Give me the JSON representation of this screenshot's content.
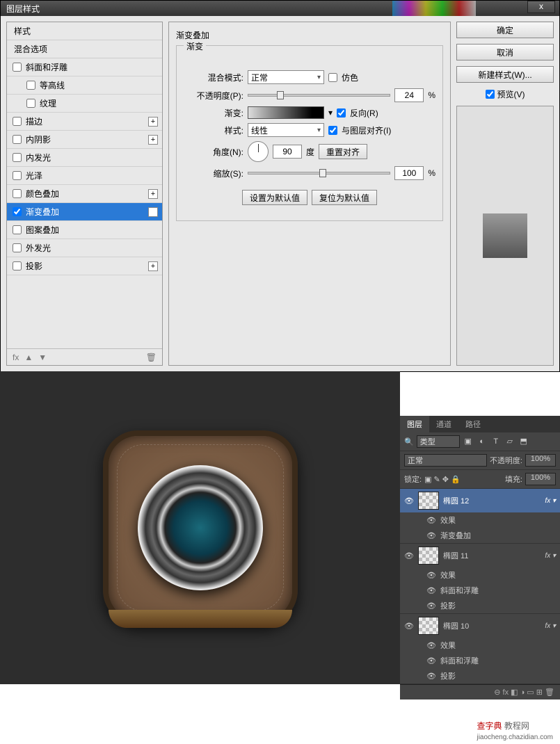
{
  "dialog": {
    "title": "图层样式",
    "close_x": "x",
    "styles": {
      "header": "样式",
      "blend_options": "混合选项",
      "items": [
        {
          "label": "斜面和浮雕",
          "checked": false,
          "indent": false,
          "plus": false
        },
        {
          "label": "等高线",
          "checked": false,
          "indent": true,
          "plus": false
        },
        {
          "label": "纹理",
          "checked": false,
          "indent": true,
          "plus": false
        },
        {
          "label": "描边",
          "checked": false,
          "indent": false,
          "plus": true
        },
        {
          "label": "内阴影",
          "checked": false,
          "indent": false,
          "plus": true
        },
        {
          "label": "内发光",
          "checked": false,
          "indent": false,
          "plus": false
        },
        {
          "label": "光泽",
          "checked": false,
          "indent": false,
          "plus": false
        },
        {
          "label": "颜色叠加",
          "checked": false,
          "indent": false,
          "plus": true
        },
        {
          "label": "渐变叠加",
          "checked": true,
          "indent": false,
          "plus": true,
          "active": true
        },
        {
          "label": "图案叠加",
          "checked": false,
          "indent": false,
          "plus": false
        },
        {
          "label": "外发光",
          "checked": false,
          "indent": false,
          "plus": false
        },
        {
          "label": "投影",
          "checked": false,
          "indent": false,
          "plus": true
        }
      ],
      "footer_fx": "fx",
      "footer_up": "▲",
      "footer_down": "▼",
      "footer_trash": "🗑"
    },
    "gradient_overlay": {
      "title": "渐变叠加",
      "group_label": "渐变",
      "blend_mode_label": "混合模式:",
      "blend_mode_value": "正常",
      "dither_label": "仿色",
      "dither_checked": false,
      "opacity_label": "不透明度(P):",
      "opacity_value": "24",
      "opacity_unit": "%",
      "gradient_label": "渐变:",
      "reverse_label": "反向(R)",
      "reverse_checked": true,
      "style_label": "样式:",
      "style_value": "线性",
      "align_label": "与图层对齐(I)",
      "align_checked": true,
      "angle_label": "角度(N):",
      "angle_value": "90",
      "angle_unit": "度",
      "reset_align": "重置对齐",
      "scale_label": "缩放(S):",
      "scale_value": "100",
      "scale_unit": "%",
      "make_default": "设置为默认值",
      "reset_default": "复位为默认值"
    },
    "buttons": {
      "ok": "确定",
      "cancel": "取消",
      "new_style": "新建样式(W)...",
      "preview": "预览(V)",
      "preview_checked": true
    }
  },
  "layers_panel": {
    "tabs": {
      "layers": "图层",
      "channels": "通道",
      "paths": "路径"
    },
    "filter_kind_icon": "🔍",
    "filter_kind": "类型",
    "icons": {
      "img": "▣",
      "adj": "◐",
      "text": "T",
      "shape": "▱",
      "smart": "⬒"
    },
    "blend_mode": "正常",
    "opacity_label": "不透明度:",
    "opacity_value": "100%",
    "lock_label": "锁定:",
    "lock_icons": "▣ ✎ ✥ 🔒",
    "fill_label": "填充:",
    "fill_value": "100%",
    "layers": [
      {
        "name": "椭圆 12",
        "active": true,
        "effects_label": "效果",
        "effects": [
          "渐变叠加"
        ]
      },
      {
        "name": "椭圆 11",
        "active": false,
        "effects_label": "效果",
        "effects": [
          "斜面和浮雕",
          "投影"
        ]
      },
      {
        "name": "椭圆 10",
        "active": false,
        "effects_label": "效果",
        "effects": [
          "斜面和浮雕",
          "投影"
        ]
      }
    ],
    "fx_text": "fx",
    "link_icon": "⬭",
    "footer_icons": "⊖  fx  ◧  ◑  ▭  ⊞  🗑"
  },
  "watermark": {
    "cn": "查字典",
    "rest": " 教程网",
    "url": "jiaocheng.chazidian.com"
  }
}
